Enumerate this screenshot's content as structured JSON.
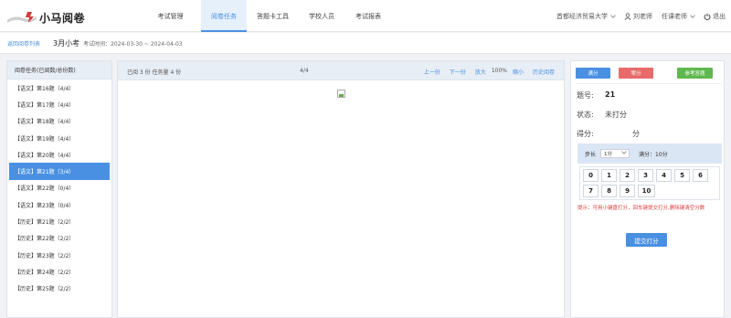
{
  "app": {
    "logo_text": "小马阅卷"
  },
  "nav": [
    {
      "label": "考试管理"
    },
    {
      "label": "阅卷任务"
    },
    {
      "label": "答题卡工具"
    },
    {
      "label": "学校人员"
    },
    {
      "label": "考试报表"
    }
  ],
  "header_right": {
    "school": "首都经济贸易大学",
    "user": "刘老师",
    "role": "任课老师",
    "logout": "退出"
  },
  "subheader": {
    "back": "返回阅卷列表",
    "exam_name": "3月小考",
    "exam_time": "考试时间：2024-03-30 ~ 2024-04-03"
  },
  "task_list": {
    "header": "阅卷任务(已阅数/总份数)",
    "active_index": 5,
    "items": [
      "【语文】第16题（4/4）",
      "【语文】第17题（4/4）",
      "【语文】第18题（4/4）",
      "【语文】第19题（4/4）",
      "【语文】第20题（4/4）",
      "【语文】第21题（3/4）",
      "【语文】第22题（0/4）",
      "【语文】第23题（0/4）",
      "【历史】第21题（2/2）",
      "【历史】第22题（2/2）",
      "【历史】第23题（2/2）",
      "【历史】第24题（2/2）",
      "【历史】第25题（2/2）"
    ]
  },
  "viewer": {
    "stats": "已阅 3 份 任务量 4 份",
    "page": "4/4",
    "prev": "上一份",
    "next": "下一份",
    "zoom_in": "放大",
    "zoom_level": "100%",
    "zoom_out": "缩小",
    "history": "历史阅卷"
  },
  "grading": {
    "full_btn": "满分",
    "zero_btn": "零分",
    "ref_btn": "参考答题",
    "question_label": "题号:",
    "question_value": "21",
    "status_label": "状态:",
    "status_value": "未打分",
    "score_label": "得分:",
    "score_unit": "分",
    "step_label": "步长",
    "step_value": "1分",
    "max_score": "满分：10分",
    "keys": [
      "0",
      "1",
      "2",
      "3",
      "4",
      "5",
      "6",
      "7",
      "8",
      "9",
      "10"
    ],
    "tip": "提示：可用小键盘打分，回车键提交打分,删除键清空分数",
    "submit": "提交打分"
  }
}
